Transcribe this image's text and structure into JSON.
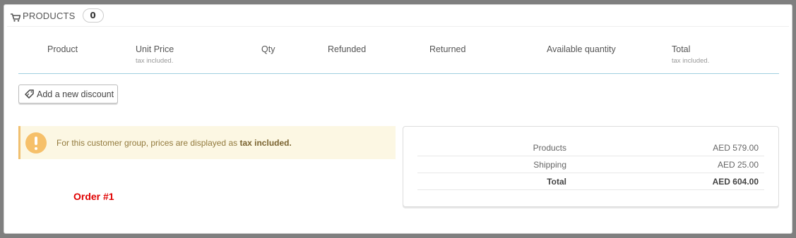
{
  "panel": {
    "title": "PRODUCTS",
    "count": "0"
  },
  "table": {
    "columns": [
      {
        "label": "Product",
        "sub": ""
      },
      {
        "label": "Unit Price",
        "sub": "tax included."
      },
      {
        "label": "Qty",
        "sub": ""
      },
      {
        "label": "Refunded",
        "sub": ""
      },
      {
        "label": "Returned",
        "sub": ""
      },
      {
        "label": "Available quantity",
        "sub": ""
      },
      {
        "label": "Total",
        "sub": "tax included."
      }
    ]
  },
  "actions": {
    "add_discount": "Add a new discount"
  },
  "alert": {
    "text": "For this customer group, prices are displayed as",
    "emphasis": "tax included."
  },
  "order_label": "Order #1",
  "totals": [
    {
      "label": "Products",
      "value": "AED 579.00"
    },
    {
      "label": "Shipping",
      "value": "AED 25.00"
    },
    {
      "label": "Total",
      "value": "AED 604.00"
    }
  ],
  "icons": {
    "heading": "shopping-cart-icon",
    "discount": "tag-icon",
    "alert": "exclamation-icon"
  },
  "colors": {
    "alert_bg": "#fcf7e3",
    "alert_icon": "#f6c06a",
    "header_border": "#a0d0e0",
    "order_label": "#e00000"
  }
}
